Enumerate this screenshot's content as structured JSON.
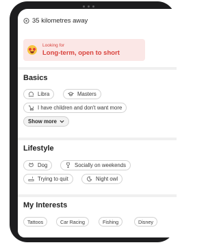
{
  "profile": {
    "distance": "35 kilometres away",
    "looking_for_label": "Looking for",
    "looking_for_value": "Long-term, open to short"
  },
  "basics": {
    "title": "Basics",
    "items": [
      {
        "label": "Libra",
        "icon": "zodiac-icon"
      },
      {
        "label": "Masters",
        "icon": "graduation-cap-icon"
      },
      {
        "label": "I have children and don't want more",
        "icon": "baby-stroller-icon"
      }
    ],
    "show_more": "Show more"
  },
  "lifestyle": {
    "title": "Lifestyle",
    "items": [
      {
        "label": "Dog",
        "icon": "dog-icon"
      },
      {
        "label": "Socially on weekends",
        "icon": "glass-icon"
      },
      {
        "label": "Trying to quit",
        "icon": "cigarette-icon"
      },
      {
        "label": "Night owl",
        "icon": "moon-icon"
      }
    ]
  },
  "interests": {
    "title": "My Interests",
    "items": [
      "Tattoos",
      "Car Racing",
      "Fishing",
      "Disney"
    ]
  },
  "colors": {
    "accent": "#d8423c",
    "looking_bg": "#fbe7e6",
    "pill_border": "#d2d2d2",
    "device": "#1d1d1f"
  }
}
